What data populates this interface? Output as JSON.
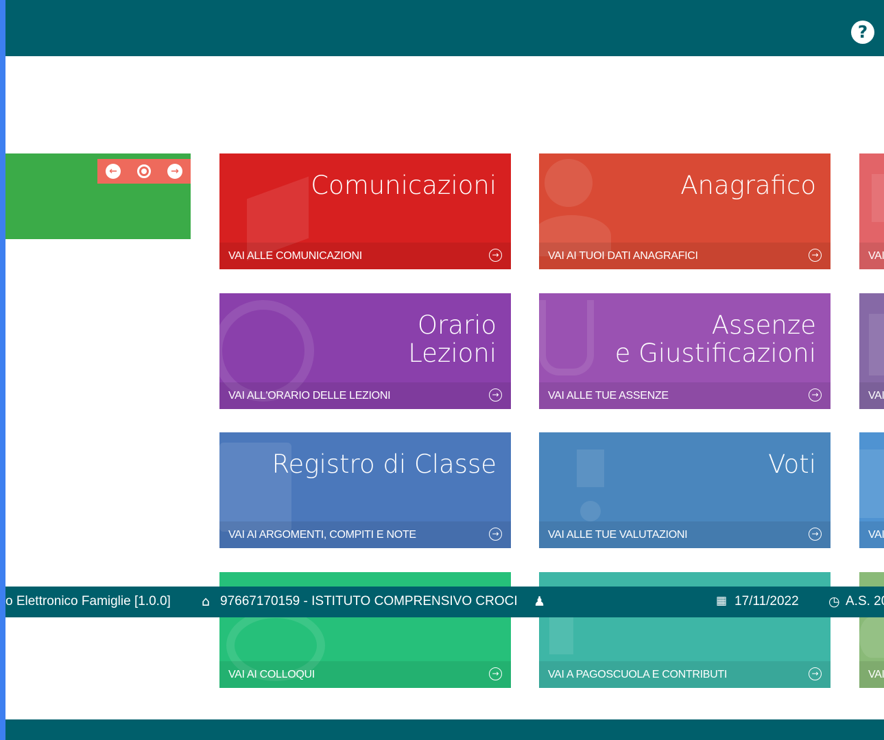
{
  "colors": {
    "header": "#005f6b",
    "left_edge": "#3d7ff0",
    "carousel_bg": "#3bab48",
    "carousel_controls": "#ee6a5c"
  },
  "carousel": {
    "prev_icon": "arrow-left-icon",
    "center_icon": "circle-icon",
    "next_icon": "arrow-right-icon"
  },
  "tiles": [
    {
      "title": "Comunicazioni",
      "link": "VAI ALLE COMUNICAZIONI",
      "color": "#d72020",
      "icon": "megaphone-icon"
    },
    {
      "title": "Anagrafico",
      "link": "VAI AI TUOI DATI ANAGRAFICI",
      "color": "#d94a35",
      "icon": "user-icon"
    },
    {
      "title": "",
      "link": "VAI",
      "color": "#e26468",
      "icon": "document-icon"
    },
    {
      "title": "Orario\nLezioni",
      "link": "VAI ALL'ORARIO DELLE LEZIONI",
      "color": "#8a40ab",
      "icon": "clock-icon"
    },
    {
      "title": "Assenze\ne Giustificazioni",
      "link": "VAI ALLE TUE ASSENZE",
      "color": "#9a52b2",
      "icon": "stethoscope-icon"
    },
    {
      "title": "",
      "link": "VAI",
      "color": "#8669a6",
      "icon": "plus-icon"
    },
    {
      "title": "Registro di Classe",
      "link": "VAI AI ARGOMENTI, COMPITI E NOTE",
      "color": "#4b78bb",
      "icon": "book-icon"
    },
    {
      "title": "Voti",
      "link": "VAI ALLE TUE VALUTAZIONI",
      "color": "#4a86bd",
      "icon": "grade-icon"
    },
    {
      "title": "",
      "link": "VAI",
      "color": "#4f93d2",
      "icon": "board-icon"
    },
    {
      "title": "",
      "link": "VAI AI COLLOQUI",
      "color": "#26c07a",
      "icon": "chat-icon"
    },
    {
      "title": "",
      "link": "VAI A PAGOSCUOLA E CONTRIBUTI",
      "color": "#3eb6a6",
      "icon": "euro-icon"
    },
    {
      "title": "",
      "link": "VAI",
      "color": "#8aba78",
      "icon": "leaf-icon"
    }
  ],
  "status": {
    "app": "o Elettronico Famiglie [1.0.0]",
    "school": "97667170159 - ISTITUTO COMPRENSIVO CROCI",
    "date": "17/11/2022",
    "year": "A.S. 20",
    "home_icon": "home-icon",
    "user_icon": "user-icon",
    "calendar_icon": "calendar-icon",
    "clock_icon": "clock-icon"
  }
}
